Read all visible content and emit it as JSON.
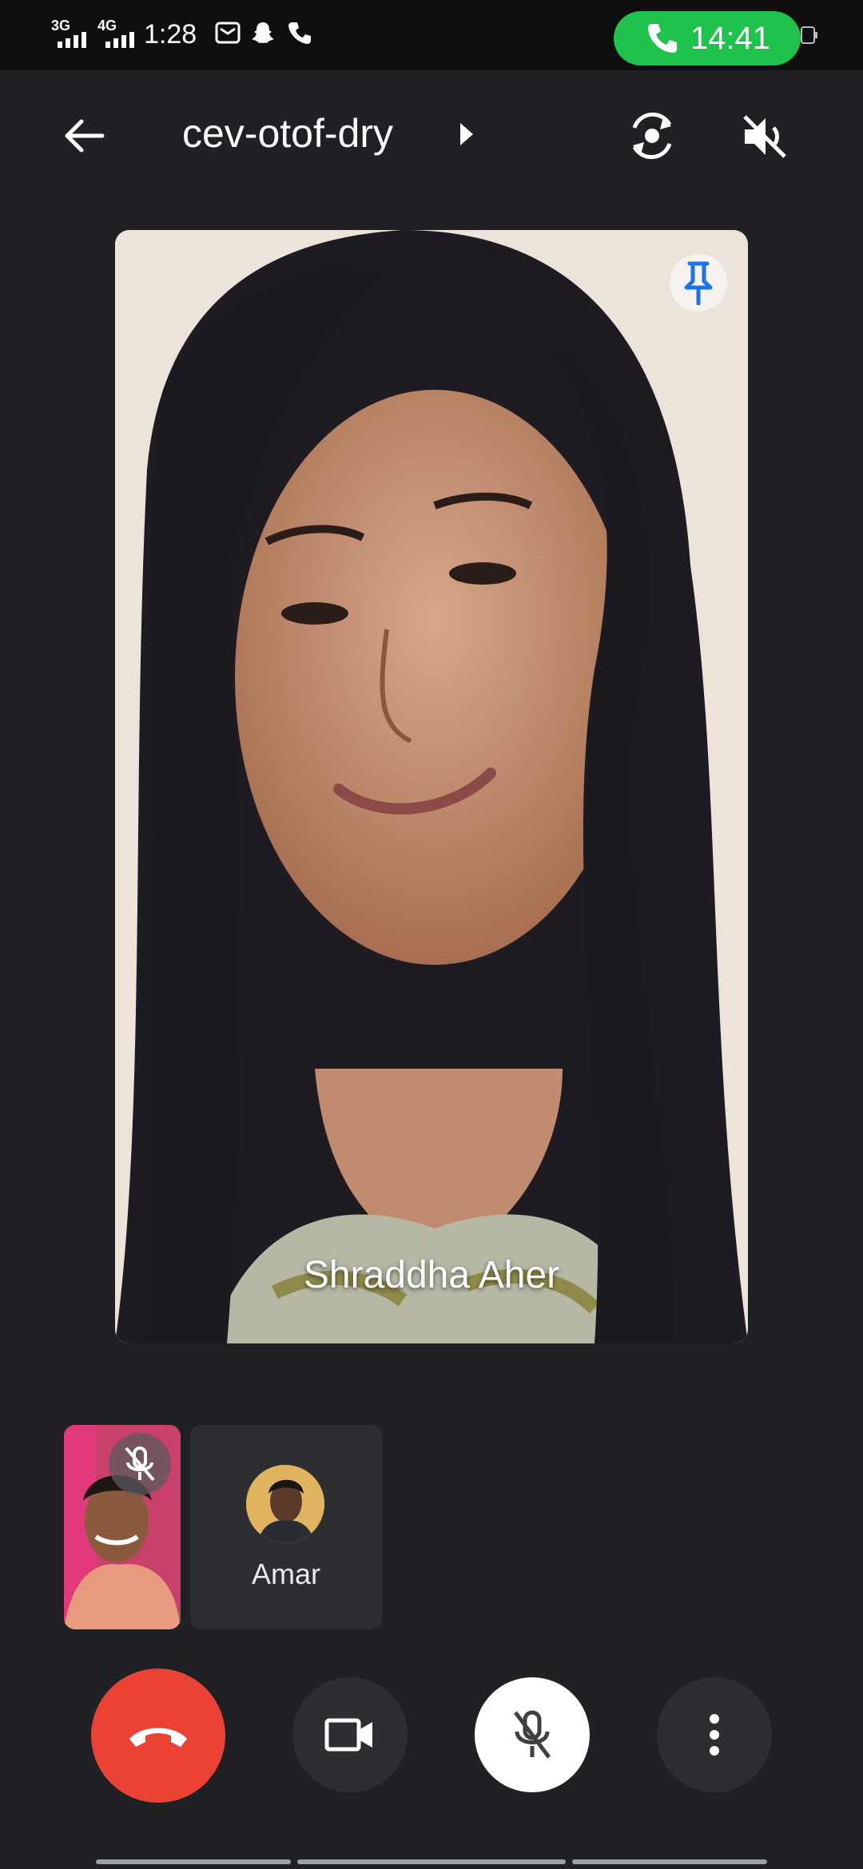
{
  "status_bar": {
    "network_1": "3G",
    "network_2": "4G",
    "time": "1:28",
    "call_timer": "14:41"
  },
  "top_bar": {
    "meeting_code": "cev-otof-dry"
  },
  "main_participant": {
    "name": "Shraddha Aher"
  },
  "participants": [
    {
      "name": "Amar"
    }
  ],
  "colors": {
    "background": "#202124",
    "end_call": "#ea4335",
    "call_pill": "#1fc24a",
    "pin_accent": "#1a73e8"
  },
  "icons": {
    "back": "back-arrow-icon",
    "flip_camera": "flip-camera-icon",
    "speaker_muted": "speaker-off-icon",
    "pin": "pin-icon",
    "end_call": "call-end-icon",
    "camera": "videocam-icon",
    "mic_off": "mic-off-icon",
    "more": "more-vert-icon"
  }
}
